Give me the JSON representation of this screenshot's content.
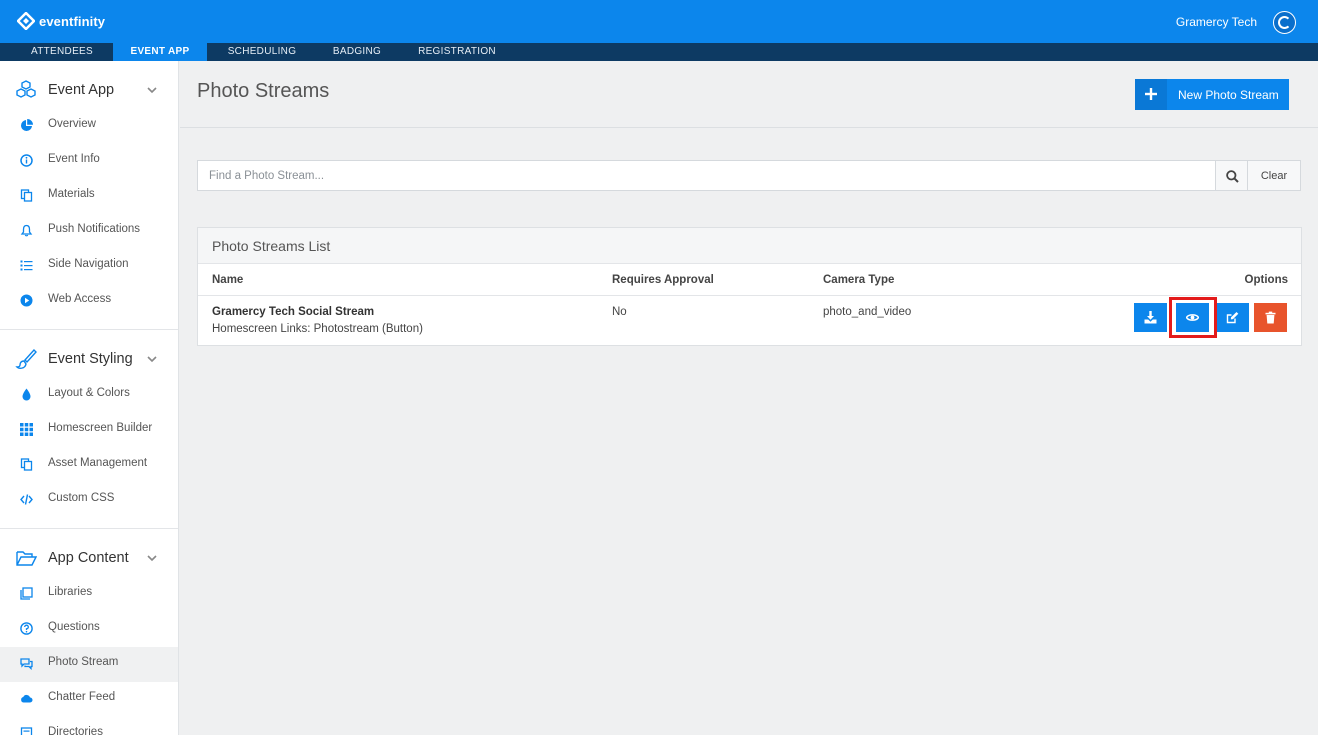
{
  "app": {
    "logo_text": "eventfinity",
    "org_name": "Gramercy Tech"
  },
  "tabs": [
    {
      "label": "ATTENDEES",
      "active": false
    },
    {
      "label": "EVENT APP",
      "active": true
    },
    {
      "label": "SCHEDULING",
      "active": false
    },
    {
      "label": "BADGING",
      "active": false
    },
    {
      "label": "REGISTRATION",
      "active": false
    }
  ],
  "sidebar": {
    "sections": [
      {
        "label": "Event App",
        "icon": "cubes-icon",
        "items": [
          {
            "label": "Overview",
            "icon": "pie-chart-icon"
          },
          {
            "label": "Event Info",
            "icon": "info-icon"
          },
          {
            "label": "Materials",
            "icon": "copy-icon"
          },
          {
            "label": "Push Notifications",
            "icon": "bell-icon"
          },
          {
            "label": "Side Navigation",
            "icon": "list-icon"
          },
          {
            "label": "Web Access",
            "icon": "play-circle-icon"
          }
        ]
      },
      {
        "label": "Event Styling",
        "icon": "paintbrush-icon",
        "items": [
          {
            "label": "Layout & Colors",
            "icon": "droplet-icon"
          },
          {
            "label": "Homescreen Builder",
            "icon": "grid-icon"
          },
          {
            "label": "Asset Management",
            "icon": "copy-icon"
          },
          {
            "label": "Custom CSS",
            "icon": "code-icon"
          }
        ]
      },
      {
        "label": "App Content",
        "icon": "folder-open-icon",
        "items": [
          {
            "label": "Libraries",
            "icon": "library-icon"
          },
          {
            "label": "Questions",
            "icon": "question-icon"
          },
          {
            "label": "Photo Stream",
            "icon": "comments-icon",
            "active": true
          },
          {
            "label": "Chatter Feed",
            "icon": "cloud-icon"
          },
          {
            "label": "Directories",
            "icon": "directory-icon"
          }
        ]
      }
    ]
  },
  "page": {
    "title": "Photo Streams",
    "new_button_label": "New Photo Stream"
  },
  "search": {
    "placeholder": "Find a Photo Stream...",
    "value": "",
    "clear_label": "Clear"
  },
  "list": {
    "title": "Photo Streams List",
    "columns": [
      "Name",
      "Requires Approval",
      "Camera Type",
      "Options"
    ],
    "rows": [
      {
        "name": "Gramercy Tech Social Stream",
        "subtitle": "Homescreen Links: Photostream (Button)",
        "requires_approval": "No",
        "camera_type": "photo_and_video"
      }
    ]
  },
  "colors": {
    "brand_blue": "#0c86ec",
    "nav_dark": "#0d3a63",
    "danger": "#e8542c",
    "highlight": "#e31b1b"
  }
}
